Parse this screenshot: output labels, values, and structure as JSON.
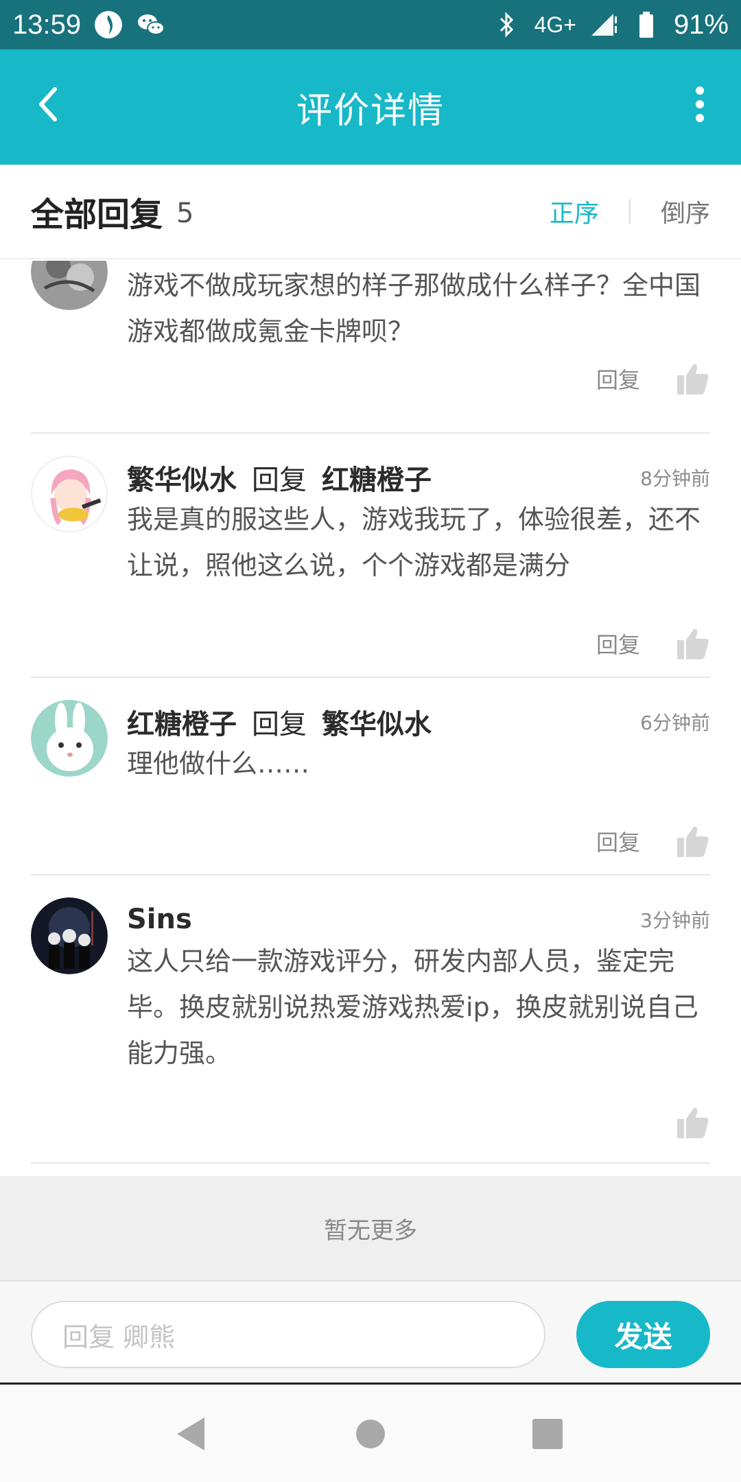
{
  "status_bar": {
    "time": "13:59",
    "network": "4G+",
    "battery": "91%",
    "icons": [
      "app-notification-icon",
      "wechat-icon",
      "bluetooth-icon",
      "signal-icon",
      "battery-icon"
    ]
  },
  "app_bar": {
    "title": "评价详情",
    "back_icon": "back-arrow-icon",
    "more_icon": "more-vertical-icon"
  },
  "section": {
    "title": "全部回复",
    "count": "5",
    "sort_asc": "正序",
    "sort_desc": "倒序",
    "active_color": "#17b8c8"
  },
  "comments": [
    {
      "author": "",
      "reply_word": "",
      "reply_to": "",
      "time": "",
      "body": "游戏不做成玩家想的样子那做成什么样子？全中国游戏都做成氪金卡牌呗？",
      "reply_label": "回复"
    },
    {
      "author": "繁华似水",
      "reply_word": "回复",
      "reply_to": "红糖橙子",
      "time": "8分钟前",
      "body": "我是真的服这些人，游戏我玩了，体验很差，还不让说，照他这么说，个个游戏都是满分",
      "reply_label": "回复"
    },
    {
      "author": "红糖橙子",
      "reply_word": "回复",
      "reply_to": "繁华似水",
      "time": "6分钟前",
      "body": "理他做什么……",
      "reply_label": "回复"
    },
    {
      "author": "Sins",
      "reply_word": "",
      "reply_to": "",
      "time": "3分钟前",
      "body": "这人只给一款游戏评分，研发内部人员，鉴定完毕。换皮就别说热爱游戏热爱ip，换皮就别说自己能力强。",
      "reply_label": ""
    }
  ],
  "footer": {
    "no_more": "暂无更多"
  },
  "input_bar": {
    "placeholder": "回复 卿熊",
    "send_label": "发送"
  },
  "nav_bar": {
    "icons": [
      "nav-back-icon",
      "nav-home-icon",
      "nav-recents-icon"
    ]
  },
  "colors": {
    "status_bar": "#17727c",
    "app_bar": "#17b8c8",
    "accent": "#17b8c8"
  }
}
